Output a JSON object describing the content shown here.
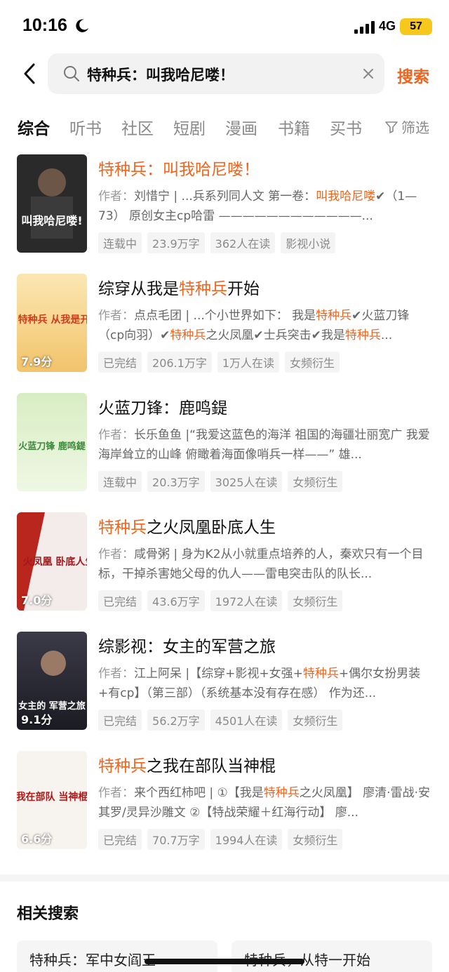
{
  "status": {
    "time": "10:16",
    "network": "4G",
    "battery": "57"
  },
  "search": {
    "query": "特种兵：叫我哈尼喽！",
    "button": "搜索"
  },
  "tabs": [
    "综合",
    "听书",
    "社区",
    "短剧",
    "漫画",
    "书籍",
    "买书"
  ],
  "filter_label": "筛选",
  "desc_prefix": "作者：",
  "results": [
    {
      "title_hl": "特种兵：叫我哈尼喽！",
      "title_rest": "",
      "author": "刘惜宁",
      "desc_a": " | ...兵系列同人文 第一卷：",
      "desc_hl": "叫我哈尼喽",
      "desc_b": "✔（1—73） 原创女主cp哈雷 ————————————...",
      "score": "",
      "tags": [
        "连载中",
        "23.9万字",
        "362人在读",
        "影视小说"
      ],
      "cover_text": "叫我哈尼喽!"
    },
    {
      "title_pre": "综穿从我是",
      "title_hl": "特种兵",
      "title_rest": "开始",
      "author": "点点毛团",
      "desc_a": " | ...个小世界如下： 我是",
      "desc_hl": "特种兵",
      "desc_b": "✔火蓝刀锋（cp向羽）✔",
      "desc_hl2": "特种兵",
      "desc_c": "之火凤凰✔士兵突击✔我是",
      "desc_hl3": "特种兵",
      "desc_d": "...",
      "score": "7.9分",
      "tags": [
        "已完结",
        "206.1万字",
        "1万人在读",
        "女频衍生"
      ],
      "cover_text": "特种兵 从我是开始"
    },
    {
      "title_pre": "火蓝刀锋：鹿鸣鍉",
      "title_hl": "",
      "title_rest": "",
      "author": "长乐鱼鱼",
      "desc_a": " |“我爱这蓝色的海洋 祖国的海疆壮丽宽广 我爱海岸耸立的山峰 俯瞰着海面像哨兵一样——” 雄...",
      "score": "",
      "tags": [
        "连载中",
        "20.3万字",
        "3025人在读",
        "女频衍生"
      ],
      "cover_text": "火蓝刀锋 鹿鸣鍉"
    },
    {
      "title_hl": "特种兵",
      "title_rest": "之火凤凰卧底人生",
      "author": "咸骨粥",
      "desc_a": " | 身为K2从小就重点培养的人，秦欢只有一个目标，干掉杀害她父母的仇人——雷电突击队的队长...",
      "score": "7.0分",
      "tags": [
        "已完结",
        "43.6万字",
        "1972人在读",
        "女频衍生"
      ],
      "cover_text": "火凤凰 卧底人生"
    },
    {
      "title_pre": "综影视：女主的军营之旅",
      "title_hl": "",
      "title_rest": "",
      "author": "江上阿呆",
      "desc_a": " |【综穿+影视+女强+",
      "desc_hl": "特种兵",
      "desc_b": "+偶尔女扮男装+有cp】（第三部）（系统基本没有存在感） 作为还...",
      "score": "9.1分",
      "tags": [
        "已完结",
        "56.2万字",
        "4501人在读",
        "女频衍生"
      ],
      "cover_text": "女主的 军营之旅"
    },
    {
      "title_hl": "特种兵",
      "title_rest": "之我在部队当神棍",
      "author": "来个西红柿吧",
      "desc_a": " | ①【我是",
      "desc_hl": "特种兵",
      "desc_b": "之火凤凰】 廖清·雷战·安其罗/灵异沙雕文 ②【特战荣耀＋红海行动】 廖...",
      "score": "6.6分",
      "tags": [
        "已完结",
        "70.7万字",
        "1994人在读",
        "女频衍生"
      ],
      "cover_text": "我在部队 当神棍"
    }
  ],
  "related": {
    "title": "相关搜索",
    "items": [
      "特种兵：军中女阎王",
      "特种兵，从特一开始"
    ]
  },
  "colors": {
    "accent": "#f0641e"
  }
}
